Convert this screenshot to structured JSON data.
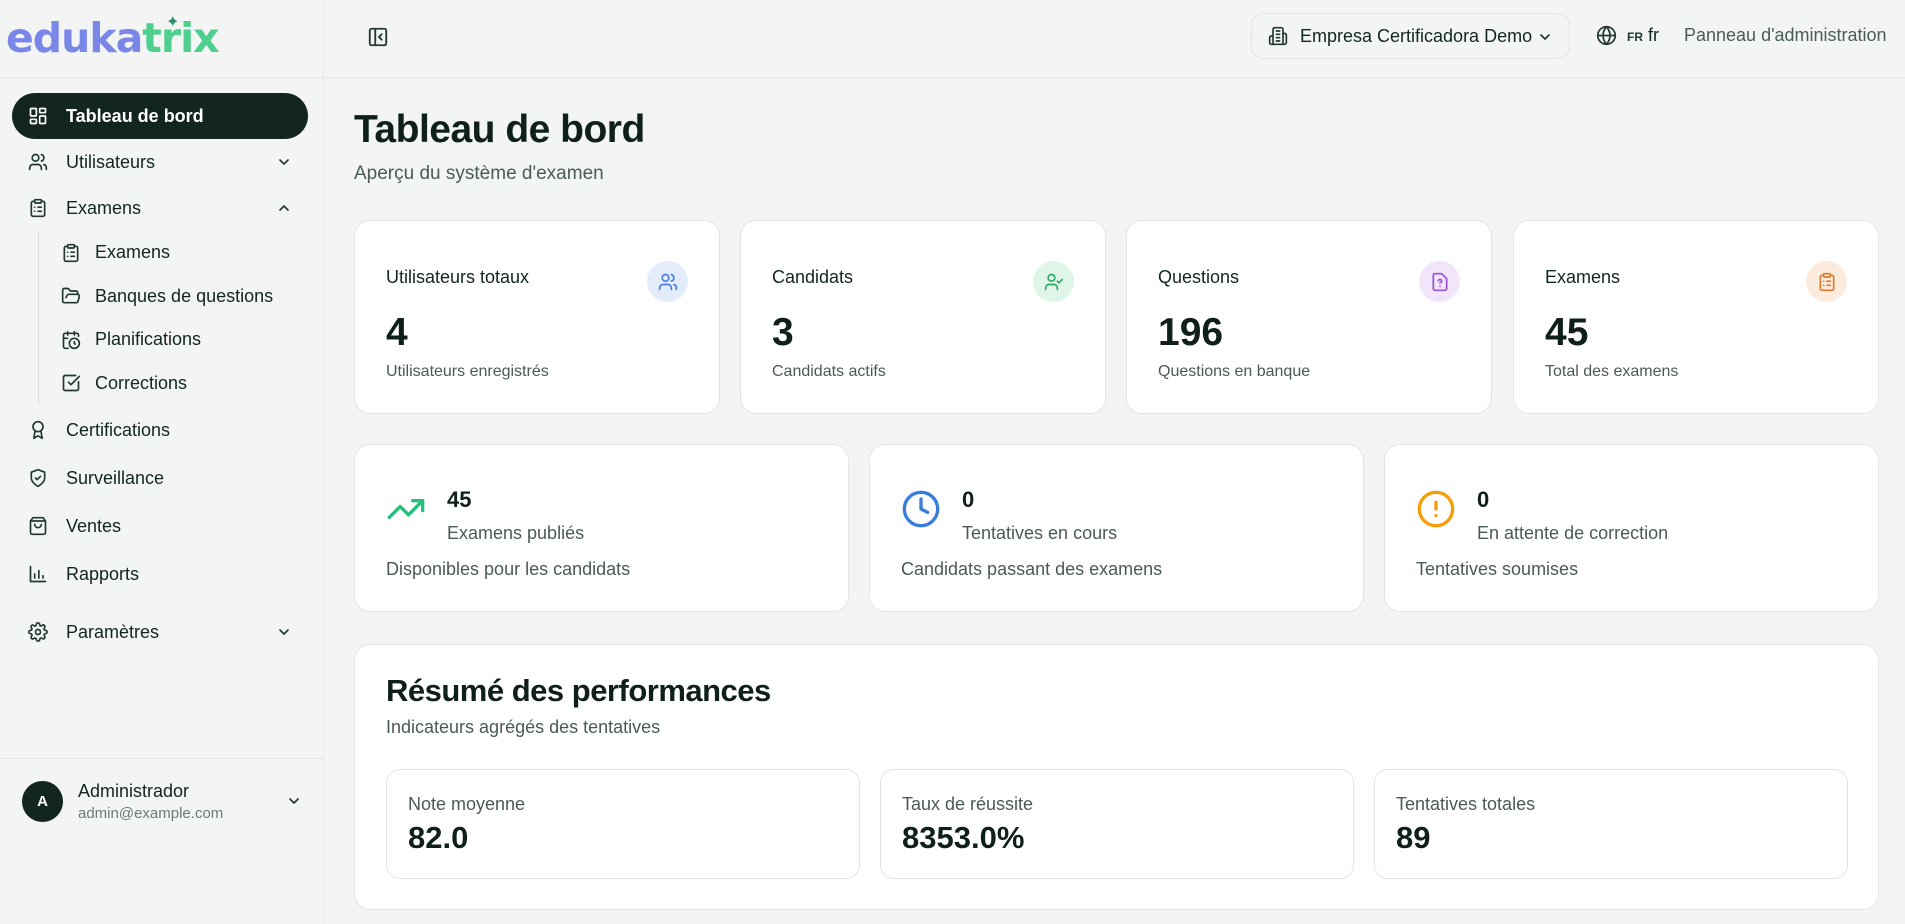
{
  "brand": {
    "part1": "eduka",
    "part2": "trix",
    "spark": "✦"
  },
  "sidebar": {
    "items": [
      {
        "label": "Tableau de bord"
      },
      {
        "label": "Utilisateurs"
      },
      {
        "label": "Examens"
      }
    ],
    "exam_sub": [
      {
        "label": "Examens"
      },
      {
        "label": "Banques de questions"
      },
      {
        "label": "Planifications"
      },
      {
        "label": "Corrections"
      }
    ],
    "items2": [
      {
        "label": "Certifications"
      },
      {
        "label": "Surveillance"
      },
      {
        "label": "Ventes"
      },
      {
        "label": "Rapports"
      },
      {
        "label": "Paramètres"
      }
    ],
    "user": {
      "initial": "A",
      "name": "Administrador",
      "email": "admin@example.com"
    }
  },
  "header": {
    "organization": "Empresa Certificadora Demo",
    "lang_code": "FR",
    "lang_value": "fr",
    "admin_link": "Panneau d'administration"
  },
  "main": {
    "title": "Tableau de bord",
    "subtitle": "Aperçu du système d'examen",
    "stats": [
      {
        "label": "Utilisateurs totaux",
        "value": "4",
        "desc": "Utilisateurs enregistrés",
        "color": "#4a7ee0",
        "bg": "#e3ecfb",
        "icon": "users-icon"
      },
      {
        "label": "Candidats",
        "value": "3",
        "desc": "Candidats actifs",
        "color": "#2eab68",
        "bg": "#dff5e8",
        "icon": "user-check-icon"
      },
      {
        "label": "Questions",
        "value": "196",
        "desc": "Questions en banque",
        "color": "#9b4fd6",
        "bg": "#f1e5fb",
        "icon": "file-question-icon"
      },
      {
        "label": "Examens",
        "value": "45",
        "desc": "Total des examens",
        "color": "#e07a2a",
        "bg": "#fcebdc",
        "icon": "clipboard-icon"
      }
    ],
    "activity": [
      {
        "value": "45",
        "label": "Examens publiés",
        "desc": "Disponibles pour les candidats",
        "color": "#22c07a",
        "icon": "trending-up-icon"
      },
      {
        "value": "0",
        "label": "Tentatives en cours",
        "desc": "Candidats passant des examens",
        "color": "#3b7ddd",
        "icon": "clock-icon"
      },
      {
        "value": "0",
        "label": "En attente de correction",
        "desc": "Tentatives soumises",
        "color": "#f59e0b",
        "icon": "alert-circle-icon"
      }
    ],
    "performance": {
      "title": "Résumé des performances",
      "subtitle": "Indicateurs agrégés des tentatives",
      "metrics": [
        {
          "label": "Note moyenne",
          "value": "82.0"
        },
        {
          "label": "Taux de réussite",
          "value": "8353.0%"
        },
        {
          "label": "Tentatives totales",
          "value": "89"
        }
      ]
    }
  }
}
